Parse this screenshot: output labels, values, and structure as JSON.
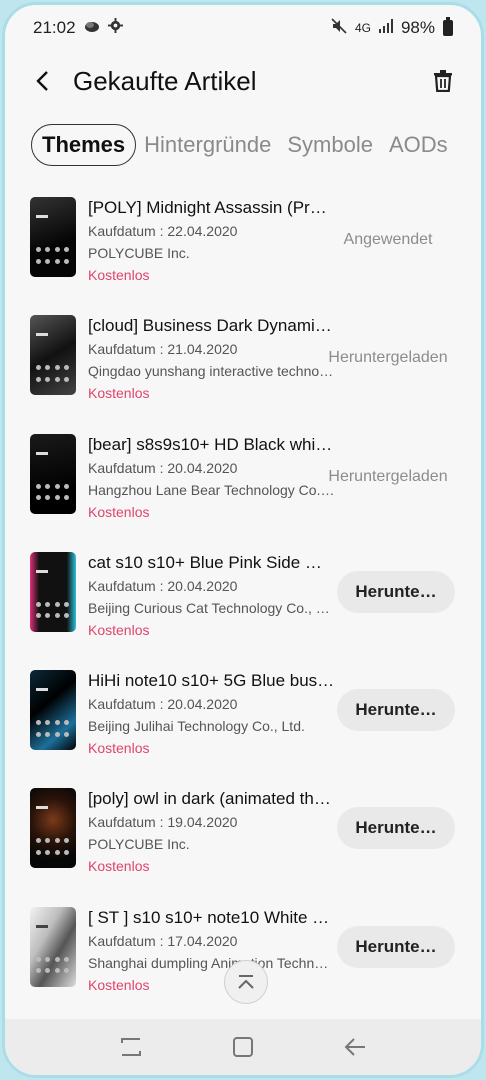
{
  "status_bar": {
    "time": "21:02",
    "battery": "98%",
    "network": "4G"
  },
  "header": {
    "title": "Gekaufte Artikel"
  },
  "tabs": [
    {
      "label": "Themes",
      "active": true
    },
    {
      "label": "Hintergründe",
      "active": false
    },
    {
      "label": "Symbole",
      "active": false
    },
    {
      "label": "AODs",
      "active": false
    }
  ],
  "items": [
    {
      "name": "[POLY] Midnight Assassin (Pre…",
      "date": "Kaufdatum : 22.04.2020",
      "vendor": "POLYCUBE Inc.",
      "price": "Kostenlos",
      "status": "Angewendet",
      "button": ""
    },
    {
      "name": "[cloud] Business Dark Dynami…",
      "date": "Kaufdatum : 21.04.2020",
      "vendor": "Qingdao yunshang interactive techno…",
      "price": "Kostenlos",
      "status": "Heruntergeladen",
      "button": ""
    },
    {
      "name": "[bear] s8s9s10+ HD Black whi…",
      "date": "Kaufdatum : 20.04.2020",
      "vendor": "Hangzhou Lane Bear Technology Co.…",
      "price": "Kostenlos",
      "status": "Heruntergeladen",
      "button": ""
    },
    {
      "name": "cat s10 s10+ Blue Pink Side …",
      "date": "Kaufdatum : 20.04.2020",
      "vendor": "Beijing Curious Cat Technology Co., …",
      "price": "Kostenlos",
      "status": "",
      "button": "Herunte…"
    },
    {
      "name": "HiHi note10 s10+ 5G Blue bus…",
      "date": "Kaufdatum : 20.04.2020",
      "vendor": "Beijing Julihai Technology Co., Ltd.",
      "price": "Kostenlos",
      "status": "",
      "button": "Herunte…"
    },
    {
      "name": "[poly] owl in dark (animated th…",
      "date": "Kaufdatum : 19.04.2020",
      "vendor": "POLYCUBE Inc.",
      "price": "Kostenlos",
      "status": "",
      "button": "Herunte…"
    },
    {
      "name": "[ ST ] s10 s10+ note10 White …",
      "date": "Kaufdatum : 17.04.2020",
      "vendor": "Shanghai dumpling Animation Techn…",
      "price": "Kostenlos",
      "status": "",
      "button": "Herunte…"
    }
  ],
  "colors": {
    "accent_price": "#e0446b",
    "background": "#f7f7f7",
    "frame": "#a9dde8"
  },
  "icons": {
    "back": "back-arrow-icon",
    "trash": "trash-icon",
    "scroll_top": "chevron-up-icon",
    "nav": [
      "recent-apps-icon",
      "home-icon",
      "back-nav-icon"
    ]
  }
}
